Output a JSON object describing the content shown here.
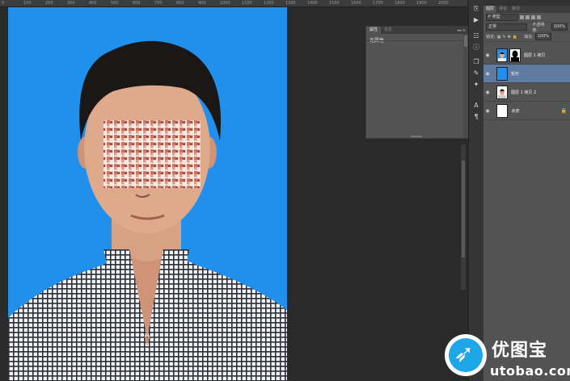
{
  "ruler": {
    "ticks": [
      "0",
      "100",
      "200",
      "300",
      "400",
      "500",
      "600",
      "700",
      "800",
      "900",
      "1000",
      "1100",
      "1200",
      "1300",
      "1400",
      "1500",
      "1600",
      "1700",
      "1800",
      "1900",
      "2000"
    ]
  },
  "properties_panel": {
    "tabs": [
      "属性",
      "信息"
    ],
    "collapse_glyph": "◂◂ ≡",
    "content": "无属性"
  },
  "layers_panel": {
    "tabs": [
      "图层",
      "通道",
      "路径"
    ],
    "kind_filter": "P 类型",
    "blend_mode": "正常",
    "opacity_label": "不透明度:",
    "opacity_value": "100%",
    "lock_label": "锁定:",
    "fill_label": "填充:",
    "fill_value": "100%",
    "layers": [
      {
        "name": "图层 1 拷贝",
        "selected": false,
        "italic": false
      },
      {
        "name": "矩形",
        "selected": true,
        "italic": false
      },
      {
        "name": "图层 1 拷贝 2",
        "selected": false,
        "italic": false
      },
      {
        "name": "背景",
        "selected": false,
        "italic": true
      }
    ]
  },
  "watermark": {
    "chinese": "优图宝",
    "domain": "utobao.com"
  },
  "colors": {
    "photo_bg": "#2090ec",
    "selected_layer": "#5f7ca0",
    "panel": "#535353"
  }
}
